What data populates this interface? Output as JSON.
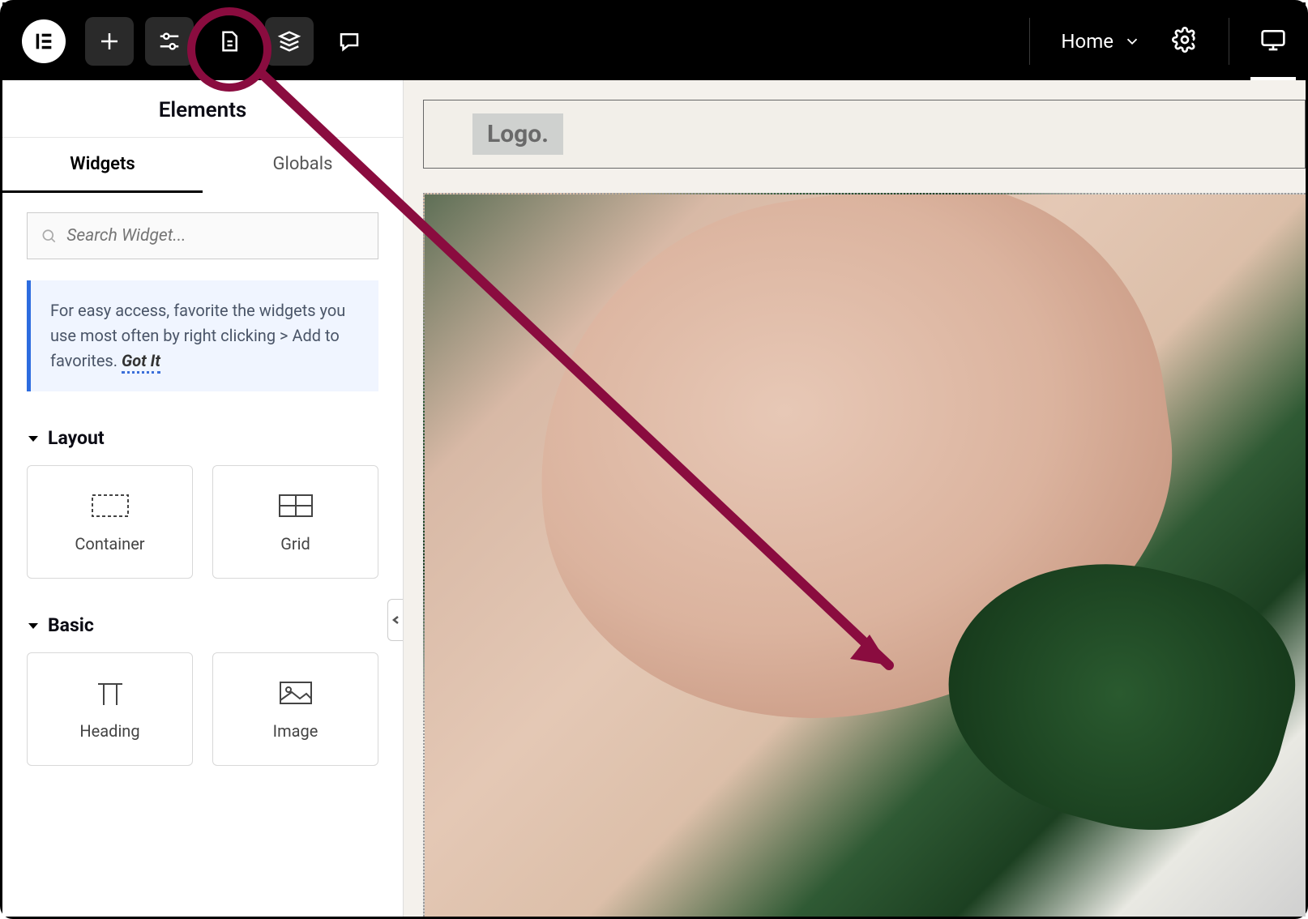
{
  "topbar": {
    "page_label": "Home"
  },
  "panel": {
    "title": "Elements",
    "tabs": {
      "widgets": "Widgets",
      "globals": "Globals"
    },
    "search_placeholder": "Search Widget...",
    "tip_text": "For easy access, favorite the widgets you use most often by right clicking > Add to favorites.",
    "tip_action": "Got It",
    "sections": {
      "layout": {
        "title": "Layout",
        "items": [
          "Container",
          "Grid"
        ]
      },
      "basic": {
        "title": "Basic",
        "items": [
          "Heading",
          "Image"
        ]
      }
    }
  },
  "canvas": {
    "logo_placeholder": "Logo."
  }
}
